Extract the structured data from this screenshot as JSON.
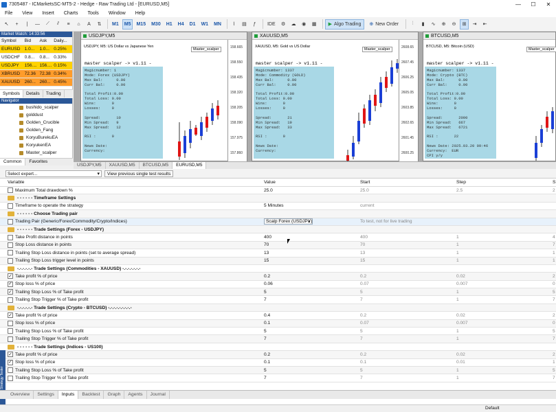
{
  "window": {
    "title": "7305487 - ICMarketsSC-MT5-2 - Hedge - Raw Trading Ltd - [EURUSD,M5]",
    "min": "—",
    "max": "☐",
    "close": "✕"
  },
  "menu": [
    "File",
    "View",
    "Insert",
    "Charts",
    "Tools",
    "Window",
    "Help"
  ],
  "toolbar": {
    "timeframes": [
      "M1",
      "M5",
      "M15",
      "M30",
      "H1",
      "H4",
      "D1",
      "W1",
      "MN"
    ],
    "active_tf": "M5",
    "ide": "IDE",
    "algo": "Algo Trading",
    "new_order": "New Order"
  },
  "market_watch": {
    "title": "Market Watch: 14:33:56",
    "headers": [
      "Symbol",
      "Bid",
      "Ask",
      "Daily..."
    ],
    "rows": [
      {
        "symbol": "EURUSD",
        "bid": "1.0...",
        "ask": "1.0...",
        "daily": "0.25%",
        "style": "y"
      },
      {
        "symbol": "USDCHF",
        "bid": "0.8...",
        "ask": "0.8...",
        "daily": "0.33%",
        "style": ""
      },
      {
        "symbol": "USDJPY",
        "bid": "156....",
        "ask": "156....",
        "daily": "0.15%",
        "style": "y"
      },
      {
        "symbol": "XBRUSD",
        "bid": "72.36",
        "ask": "72.38",
        "daily": "0.34%",
        "style": "o"
      },
      {
        "symbol": "XAUUSD",
        "bid": "260...",
        "ask": "260...",
        "daily": "0.45%",
        "style": "o"
      }
    ],
    "tabs": [
      "Symbols",
      "Details",
      "Trading"
    ]
  },
  "navigator": {
    "title": "Navigator",
    "items": [
      "bushido_scalper",
      "golddust",
      "Golden_Crucible",
      "Golden_Fang",
      "KoryuBurekuEA",
      "KoryukenEA",
      "Master_scalper"
    ],
    "tabs": [
      "Common",
      "Favorites"
    ]
  },
  "charts": [
    {
      "tab": "USDJPY,M5",
      "sym": "USDJPY, M5: US Dollar vs Japanese Yen",
      "ea": "Master_scalper",
      "ticks": [
        "158.665",
        "158.550",
        "158.435",
        "158.320",
        "158.205",
        "158.090",
        "157.975",
        "157.860"
      ],
      "panel": {
        "head": "master scalper -> v1.11 -",
        "lines": [
          "Magicnumber: 1",
          "Mode: Forex (USDJPY)",
          "Max Bal:      0.00",
          "Curr Bal:     0.00",
          "",
          "Total Profit:0.00",
          "Total Loss: 0.00",
          "Wins:       0",
          "Losses:     0",
          "",
          "Spread:       10",
          "Min Spread:   9",
          "Max Spread:   12",
          "",
          "RSI :       0",
          "",
          "News Date:",
          "Currency:"
        ]
      }
    },
    {
      "tab": "XAUUSD,M5",
      "sym": "XAUUSD, M5: Gold vs US Dollar",
      "ea": "Master_scalper",
      "ticks": [
        "2608.65",
        "2607.45",
        "2606.25",
        "2605.05",
        "2603.85",
        "2602.65",
        "2601.45",
        "2600.25"
      ],
      "panel": {
        "head": "master scalper -> v1.11 -",
        "lines": [
          "Magicnumber: 1337",
          "Mode: Commodity (GOLD)",
          "Max Bal:      0.00",
          "Curr Bal:     0.00",
          "",
          "Total Profit:0.00",
          "Total Loss: 0.00",
          "Wins:       0",
          "Losses:     0",
          "",
          "Spread:       21",
          "Min Spread:   19",
          "Max Spread:   33",
          "",
          "RSI :       0",
          "",
          "News Date:",
          "Currency:"
        ]
      }
    },
    {
      "tab": "BTCUSD,M5",
      "sym": "BTCUSD, M5: Bitcoin (USD)",
      "ea": "Master_scalper",
      "ticks": [
        "",
        "",
        "",
        "",
        "",
        "",
        "",
        ""
      ],
      "panel": {
        "head": "master scalper -> v1.11 -",
        "lines": [
          "Magicnumber: 1337",
          "Mode: Crypto (BTC)",
          "Max Bal:      0.00",
          "Curr Bal:     0.00",
          "",
          "Total Profit:0.00",
          "Total Loss: 0.00",
          "Wins:       0",
          "Losses:     0",
          "",
          "Spread:       2000",
          "Min Spread:   667",
          "Max Spread:   6721",
          "",
          "RSI :       22",
          "",
          "News Date: 2025.03.20 09:46",
          "Currency:  EUR",
          "CPI y/y"
        ]
      }
    }
  ],
  "chart_tabs": [
    "USDJPY,M5",
    "XAUUSD,M5",
    "BTCUSD,M5",
    "EURUSD,M5"
  ],
  "strategy": {
    "select_expert": "Select expert...",
    "view_btn": "View previous single test results",
    "headers": {
      "variable": "Variable",
      "value": "Value",
      "start": "Start",
      "step": "Step",
      "stop": "S"
    },
    "rows": [
      {
        "t": "p",
        "name": "Maximum Total drawdown %",
        "value": "25.0",
        "start": "25.0",
        "step": "2.5",
        "stop": "2"
      },
      {
        "t": "g",
        "name": "- - - - - - Timeframe Settings",
        "value": "",
        "start": "",
        "step": "",
        "stop": ""
      },
      {
        "t": "p",
        "name": "Timeframe to operate the strategy",
        "value": "5 Minutes",
        "start": "current",
        "step": "",
        "stop": ""
      },
      {
        "t": "g",
        "name": "- - - - - - Choose Trading pair",
        "value": "",
        "start": "",
        "step": "",
        "stop": ""
      },
      {
        "t": "d",
        "name": "Trading Pair (Generic/Forex/Commodity/Crypto/Indices)",
        "value": "Scalp Forex (USDJPY)",
        "start": "To test, not for live trading",
        "step": "",
        "stop": ""
      },
      {
        "t": "g",
        "name": "- - - - - - Trade Settings (Forex - USDJPY)",
        "value": "",
        "start": "",
        "step": "",
        "stop": ""
      },
      {
        "t": "p",
        "name": "Take Profit distance in points",
        "value": "400",
        "start": "400",
        "step": "1",
        "stop": "4"
      },
      {
        "t": "p",
        "name": "Stop Loss distance in points",
        "value": "70",
        "start": "70",
        "step": "1",
        "stop": "7"
      },
      {
        "t": "p",
        "name": "Trailing Stop Loss distance in points (set to average spread)",
        "value": "13",
        "start": "13",
        "step": "1",
        "stop": "1"
      },
      {
        "t": "p",
        "name": "Trailing Stop Loss trigger level in points",
        "value": "15",
        "start": "15",
        "step": "1",
        "stop": "1"
      },
      {
        "t": "g",
        "name": "-.-.-.-.-.- Trade Settings (Commodities - XAUUSD) -.-.-.-.-.-.-",
        "value": "",
        "start": "",
        "step": "",
        "stop": ""
      },
      {
        "t": "c",
        "name": "Take profit % of price",
        "value": "0.2",
        "start": "0.2",
        "step": "0.02",
        "stop": "2"
      },
      {
        "t": "c",
        "name": "Stop loss % of price",
        "value": "0.06",
        "start": "0.07",
        "step": "0.007",
        "stop": "0"
      },
      {
        "t": "c",
        "name": "Trailing Stop Loss % of Take profit",
        "value": "5",
        "start": "5",
        "step": "1",
        "stop": "5"
      },
      {
        "t": "p",
        "name": "Trailing Stop Trigger % of Take profit",
        "value": "7",
        "start": "7",
        "step": "1",
        "stop": "7"
      },
      {
        "t": "g",
        "name": "-.-.-.-.-.- Trade Settings (Crypto - BTCUSD) -.-.-.-.-.-.-.-.-",
        "value": "",
        "start": "",
        "step": "",
        "stop": ""
      },
      {
        "t": "c",
        "name": "Take profit % of price",
        "value": "0.4",
        "start": "0.2",
        "step": "0.02",
        "stop": "2"
      },
      {
        "t": "p",
        "name": "Stop loss % of price",
        "value": "0.1",
        "start": "0.07",
        "step": "0.007",
        "stop": "0"
      },
      {
        "t": "p",
        "name": "Trailing Stop Loss % of Take profit",
        "value": "5",
        "start": "5",
        "step": "1",
        "stop": "5"
      },
      {
        "t": "p",
        "name": "Trailing Stop Trigger % of Take profit",
        "value": "7",
        "start": "7",
        "step": "1",
        "stop": "7"
      },
      {
        "t": "g",
        "name": "- - - - - - Trade Settings (Indices - US100)",
        "value": "",
        "start": "",
        "step": "",
        "stop": ""
      },
      {
        "t": "c",
        "name": "Take profit % of price",
        "value": "0.2",
        "start": "0.2",
        "step": "0.02",
        "stop": "2"
      },
      {
        "t": "c",
        "name": "Stop loss % of price",
        "value": "0.1",
        "start": "0.1",
        "step": "0.01",
        "stop": "1"
      },
      {
        "t": "p",
        "name": "Trailing Stop Loss % of Take profit",
        "value": "5",
        "start": "5",
        "step": "1",
        "stop": "5"
      },
      {
        "t": "p",
        "name": "Trailing Stop Trigger % of Take profit",
        "value": "7",
        "start": "7",
        "step": "1",
        "stop": "7"
      }
    ],
    "tabs": [
      "Overview",
      "Settings",
      "Inputs",
      "Backtest",
      "Graph",
      "Agents",
      "Journal"
    ],
    "active_tab": "Inputs",
    "sidebar_label": "Strategy Tester"
  },
  "status": "Default",
  "colors": {
    "bull": "#1a3fd6",
    "bear": "#e01616",
    "panel": "#a9d8e6"
  }
}
